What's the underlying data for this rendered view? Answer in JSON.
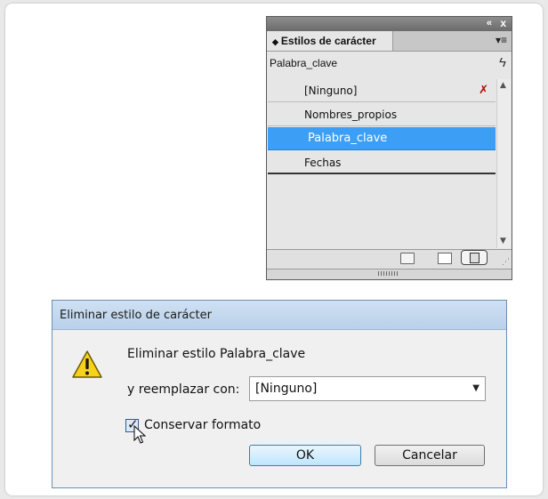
{
  "panel": {
    "tab_label": "Estilos de carácter",
    "current_style": "Palabra_clave",
    "styles": [
      {
        "label": "[Ninguno]",
        "selected": false
      },
      {
        "label": "Nombres_propios",
        "selected": false
      },
      {
        "label": "Palabra_clave",
        "selected": true
      },
      {
        "label": "Fechas",
        "selected": false
      }
    ],
    "titlebar_collapse": "«",
    "titlebar_close": "x",
    "menu_glyph": "▾≡",
    "quick_apply_glyph": "ϟ",
    "selection_color": "#3c9ef4"
  },
  "dialog": {
    "title": "Eliminar estilo de carácter",
    "message": "Eliminar estilo Palabra_clave",
    "replace_label": "y reemplazar con:",
    "replace_value": "[Ninguno]",
    "checkbox_label": "Conservar formato",
    "checkbox_checked": true,
    "ok_label": "OK",
    "cancel_label": "Cancelar",
    "icon": "warning-icon"
  }
}
